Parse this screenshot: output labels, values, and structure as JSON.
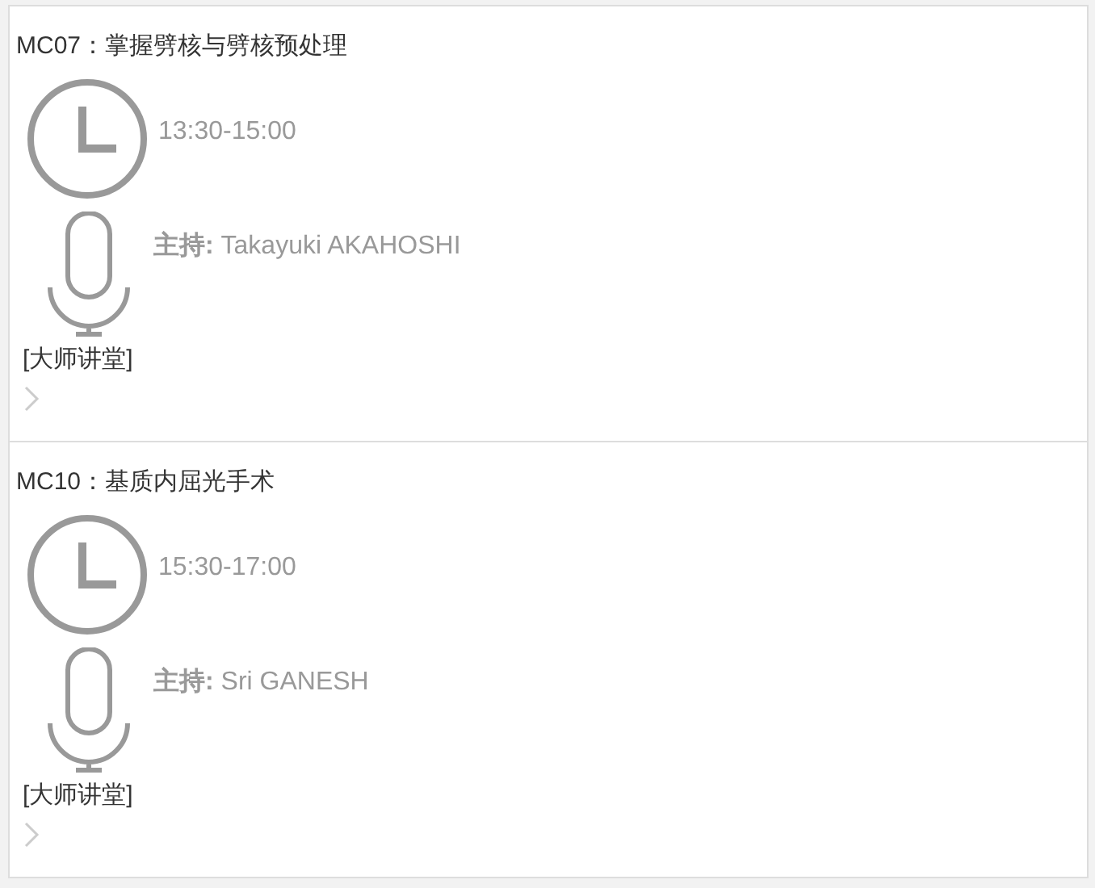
{
  "sessions": [
    {
      "title": "MC07：掌握劈核与劈核预处理",
      "time": "13:30-15:00",
      "host": "**主持:** Takayuki AKAHOSHI",
      "tag": "[大师讲堂]"
    },
    {
      "title": "MC10：基质内屈光手术",
      "time": "15:30-17:00",
      "host": "**主持:** Sri GANESH",
      "tag": "[大师讲堂]"
    }
  ]
}
